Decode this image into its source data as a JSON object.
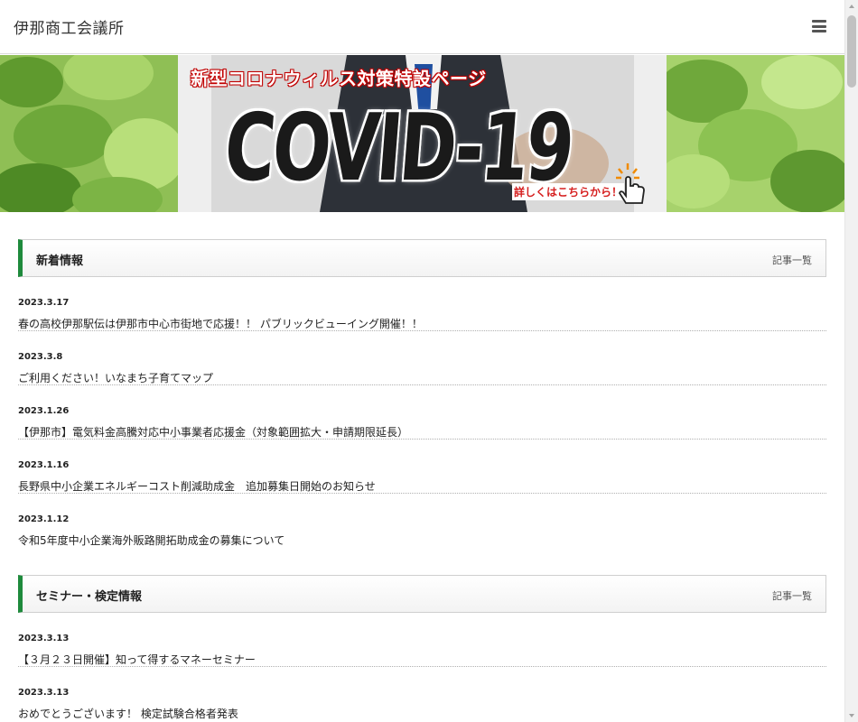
{
  "header": {
    "site_title": "伊那商工会議所",
    "menu_icon": "hamburger-icon"
  },
  "banner": {
    "headline": "新型コロナウィルス対策特設ページ",
    "covid_text": "COVID-19",
    "cta": "詳しくはこちらから！",
    "cta_icon": "pointing-hand-icon",
    "colors": {
      "leaf_green": "#7fb04a",
      "headline_red": "#cc0000"
    }
  },
  "sections": [
    {
      "title": "新着情報",
      "more_label": "記事一覧",
      "items": [
        {
          "date": "2023.3.17",
          "title": "春の高校伊那駅伝は伊那市中心市街地で応援！！ パブリックビューイング開催！！"
        },
        {
          "date": "2023.3.8",
          "title": "ご利用ください！いなまち子育てマップ"
        },
        {
          "date": "2023.1.26",
          "title": "【伊那市】電気料金高騰対応中小事業者応援金（対象範囲拡大・申請期限延長）"
        },
        {
          "date": "2023.1.16",
          "title": "長野県中小企業エネルギーコスト削減助成金　追加募集日開始のお知らせ"
        },
        {
          "date": "2023.1.12",
          "title": "令和5年度中小企業海外販路開拓助成金の募集について"
        }
      ]
    },
    {
      "title": "セミナー・検定情報",
      "more_label": "記事一覧",
      "items": [
        {
          "date": "2023.3.13",
          "title": "【３月２３日開催】知って得するマネーセミナー"
        },
        {
          "date": "2023.3.13",
          "title": "おめでとうございます！ 検定試験合格者発表"
        }
      ]
    }
  ],
  "theme": {
    "accent": "#1e8a3c"
  }
}
